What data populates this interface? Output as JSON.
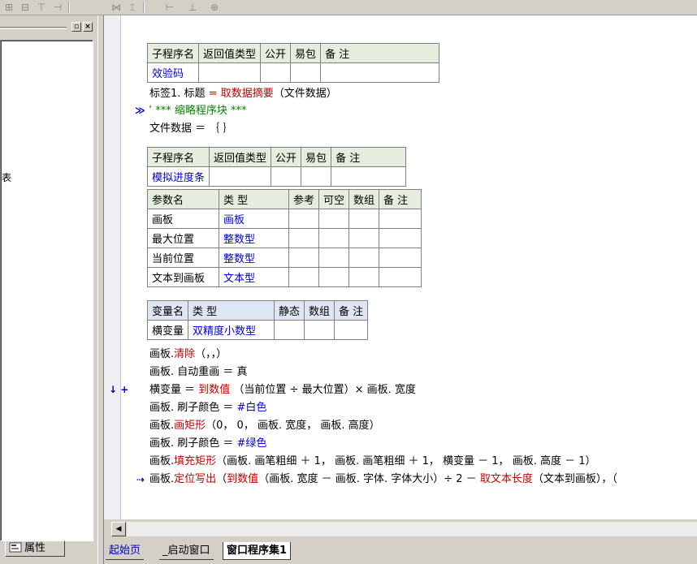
{
  "toolbar": {
    "icons": [
      "align-left-icon",
      "align-center-icon",
      "align-top-icon",
      "align-middle-icon",
      "distribute-h-icon",
      "distribute-v-icon",
      "same-width-icon",
      "same-height-icon",
      "same-size-icon"
    ]
  },
  "left_panel": {
    "tree_fragment": "表",
    "properties_tab_label": "属性"
  },
  "code": {
    "sub1": {
      "headers": [
        "子程序名",
        "返回值类型",
        "公开",
        "易包",
        "备 注"
      ],
      "row": [
        "效验码",
        "",
        "",
        "",
        ""
      ]
    },
    "line_label_assign": {
      "prefix": "标签1. 标题",
      "op": "=",
      "func": "取数据摘要",
      "args": "（文件数据）"
    },
    "collapsed_block": "’ *** 缩略程序块 ***",
    "line_file_data": "文件数据 ＝ ｛ ｝",
    "sub2": {
      "headers": [
        "子程序名",
        "返回值类型",
        "公开",
        "易包",
        "备 注"
      ],
      "row": [
        "模拟进度条",
        "",
        "",
        "",
        ""
      ]
    },
    "params": {
      "headers": [
        "参数名",
        "类 型",
        "参考",
        "可空",
        "数组",
        "备 注"
      ],
      "rows": [
        [
          "画板",
          "画板",
          "",
          "",
          "",
          ""
        ],
        [
          "最大位置",
          "整数型",
          "",
          "",
          "",
          ""
        ],
        [
          "当前位置",
          "整数型",
          "",
          "",
          "",
          ""
        ],
        [
          "文本到画板",
          "文本型",
          "",
          "",
          "",
          ""
        ]
      ]
    },
    "vars": {
      "headers": [
        "变量名",
        "类 型",
        "静态",
        "数组",
        "备 注"
      ],
      "rows": [
        [
          "横变量",
          "双精度小数型",
          "",
          "",
          ""
        ]
      ]
    },
    "lines": {
      "l1_obj": "画板.",
      "l1_func": "清除",
      "l1_args": "（，，）",
      "l2": "画板. 自动重画 ＝ 真",
      "l3_a": "横变量 ＝ ",
      "l3_func": "到数值",
      "l3_b": " （当前位置 ÷ 最大位置）× 画板. 宽度",
      "l4_a": "画板. 刷子颜色 ＝ ",
      "l4_b": "#白色",
      "l5_obj": "画板.",
      "l5_func": "画矩形",
      "l5_args": "（0， 0， 画板. 宽度， 画板. 高度）",
      "l6_a": "画板. 刷子颜色 ＝ ",
      "l6_b": "#绿色",
      "l7_obj": "画板.",
      "l7_func": "填充矩形",
      "l7_args": "（画板. 画笔粗细 ＋ 1， 画板. 画笔粗细 ＋ 1， 横变量 － 1， 画板. 高度 － 1）",
      "l8_obj": "画板.",
      "l8_func": "定位写出",
      "l8_mid": "（",
      "l8_func2": "到数值",
      "l8_b": "（画板. 宽度 － 画板. 字体. 字体大小）÷ 2 － ",
      "l8_func3": "取文本长度",
      "l8_c": "（文本到画板），（"
    },
    "markers": {
      "collapse": "≫",
      "current": "↓ +",
      "expand": "⇢"
    }
  },
  "tabs": [
    "起始页",
    "_启动窗口",
    "窗口程序集1"
  ]
}
